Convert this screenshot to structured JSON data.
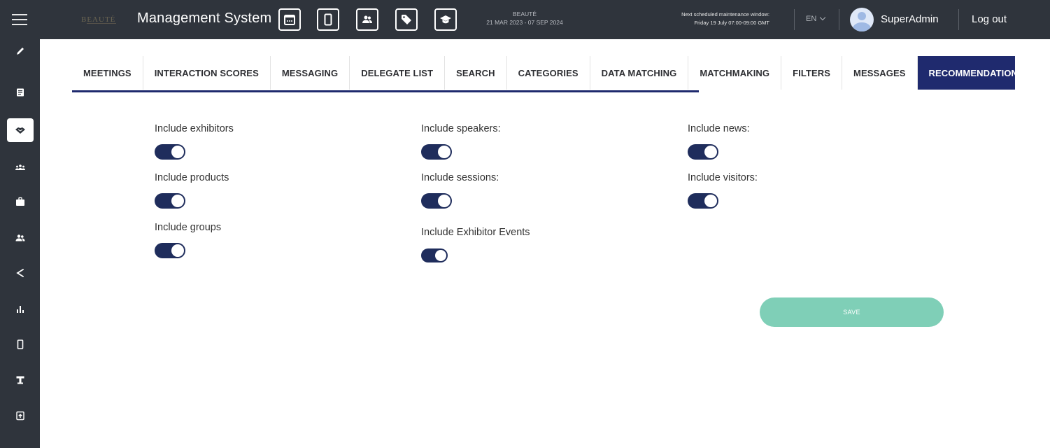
{
  "header": {
    "brand_logo_text": "BEAUTÉ",
    "title": "Management System",
    "event_name": "BEAUTÉ",
    "event_dates": "21 MAR 2023 - 07 SEP 2024",
    "maintenance_line1": "Next scheduled maintenance window:",
    "maintenance_line2": "Friday 19 July 07:00-09:00 GMT",
    "language": "EN",
    "user_name": "SuperAdmin",
    "logout_label": "Log out",
    "toolbar_icons": [
      "calendar-icon",
      "mobile-icon",
      "users-icon",
      "tag-icon",
      "graduation-cap-icon"
    ]
  },
  "sidebar": {
    "items": [
      "pencil-icon",
      "document-list-icon",
      "handshake-icon",
      "audience-icon",
      "briefcase-icon",
      "users-icon",
      "share-icon",
      "bar-chart-icon",
      "mobile-icon",
      "kiosk-icon",
      "file-upload-icon"
    ],
    "active_item": "handshake-icon"
  },
  "tabs": {
    "items": [
      "MEETINGS",
      "INTERACTION SCORES",
      "MESSAGING",
      "DELEGATE LIST",
      "SEARCH",
      "CATEGORIES",
      "DATA MATCHING",
      "MATCHMAKING",
      "FILTERS",
      "MESSAGES",
      "RECOMMENDATIONS"
    ],
    "active": "RECOMMENDATIONS"
  },
  "options": {
    "exhibitors": {
      "label": "Include exhibitors",
      "enabled": true
    },
    "products": {
      "label": "Include products",
      "enabled": true
    },
    "groups": {
      "label": "Include groups",
      "enabled": true
    },
    "speakers": {
      "label": "Include speakers:",
      "enabled": true
    },
    "sessions": {
      "label": "Include sessions:",
      "enabled": true
    },
    "exhibitor_events": {
      "label": "Include Exhibitor Events",
      "enabled": true
    },
    "news": {
      "label": "Include news:",
      "enabled": true
    },
    "visitors": {
      "label": "Include visitors:",
      "enabled": true
    }
  },
  "actions": {
    "save_label": "SAVE"
  },
  "colors": {
    "topbar_bg": "#2f343c",
    "accent_navy": "#1f2a6e",
    "toggle_on": "#1f2d5c",
    "save_button": "#7fcfb7"
  }
}
